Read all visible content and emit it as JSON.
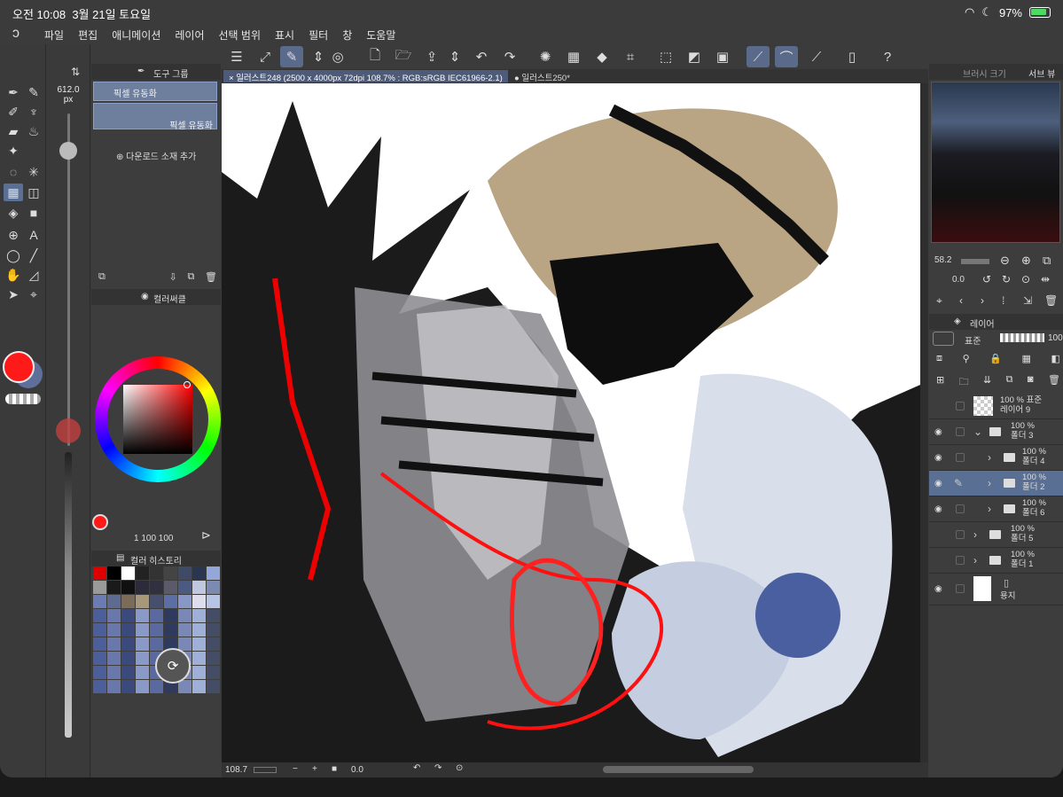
{
  "status": {
    "time": "오전 10:08",
    "date": "3월 21일 토요일",
    "battery": "97%"
  },
  "menu": [
    "파일",
    "편집",
    "애니메이션",
    "레이어",
    "선택 범위",
    "표시",
    "필터",
    "창",
    "도움말"
  ],
  "brush": {
    "size": "612.0",
    "unit": "px"
  },
  "tool_property": {
    "header": "도구 그룹",
    "subtool_1": "픽셀 유동화",
    "subtool_2": "픽셀 유동화",
    "add_material": "다운로드 소재 추가"
  },
  "color_panel": {
    "header": "컬러써클",
    "values": "1  100  100",
    "fg_color": "#ff1a1a",
    "bg_color": "#5e6f9a"
  },
  "history_panel": {
    "header": "컬러 히스토리"
  },
  "canvas_tabs": [
    {
      "label": "일러스트248 (2500 x 4000px 72dpi 108.7% : RGB:sRGB IEC61966-2.1)"
    },
    {
      "label": "일러스트250*"
    }
  ],
  "bottombar": {
    "zoom": "108.7",
    "rotation": "0.0"
  },
  "navigator": {
    "tab1": "브러시 크기",
    "tab2": "서브 뷰",
    "zoom": "58.2",
    "angle": "0.0"
  },
  "layers": {
    "header": "레이어",
    "blend": "표준",
    "opacity": "100",
    "items": [
      {
        "opacity": "100 %",
        "blend": "표준",
        "name": "레이어 9"
      },
      {
        "opacity": "100 %",
        "blend": "",
        "name": "폴더 3"
      },
      {
        "opacity": "100 %",
        "blend": "",
        "name": "폴더 4"
      },
      {
        "opacity": "100 %",
        "blend": "",
        "name": "폴더 2"
      },
      {
        "opacity": "100 %",
        "blend": "",
        "name": "폴더 6"
      },
      {
        "opacity": "100 %",
        "blend": "",
        "name": "폴더 5"
      },
      {
        "opacity": "100 %",
        "blend": "",
        "name": "폴더 1"
      },
      {
        "opacity": "",
        "blend": "",
        "name": "용지"
      }
    ]
  }
}
